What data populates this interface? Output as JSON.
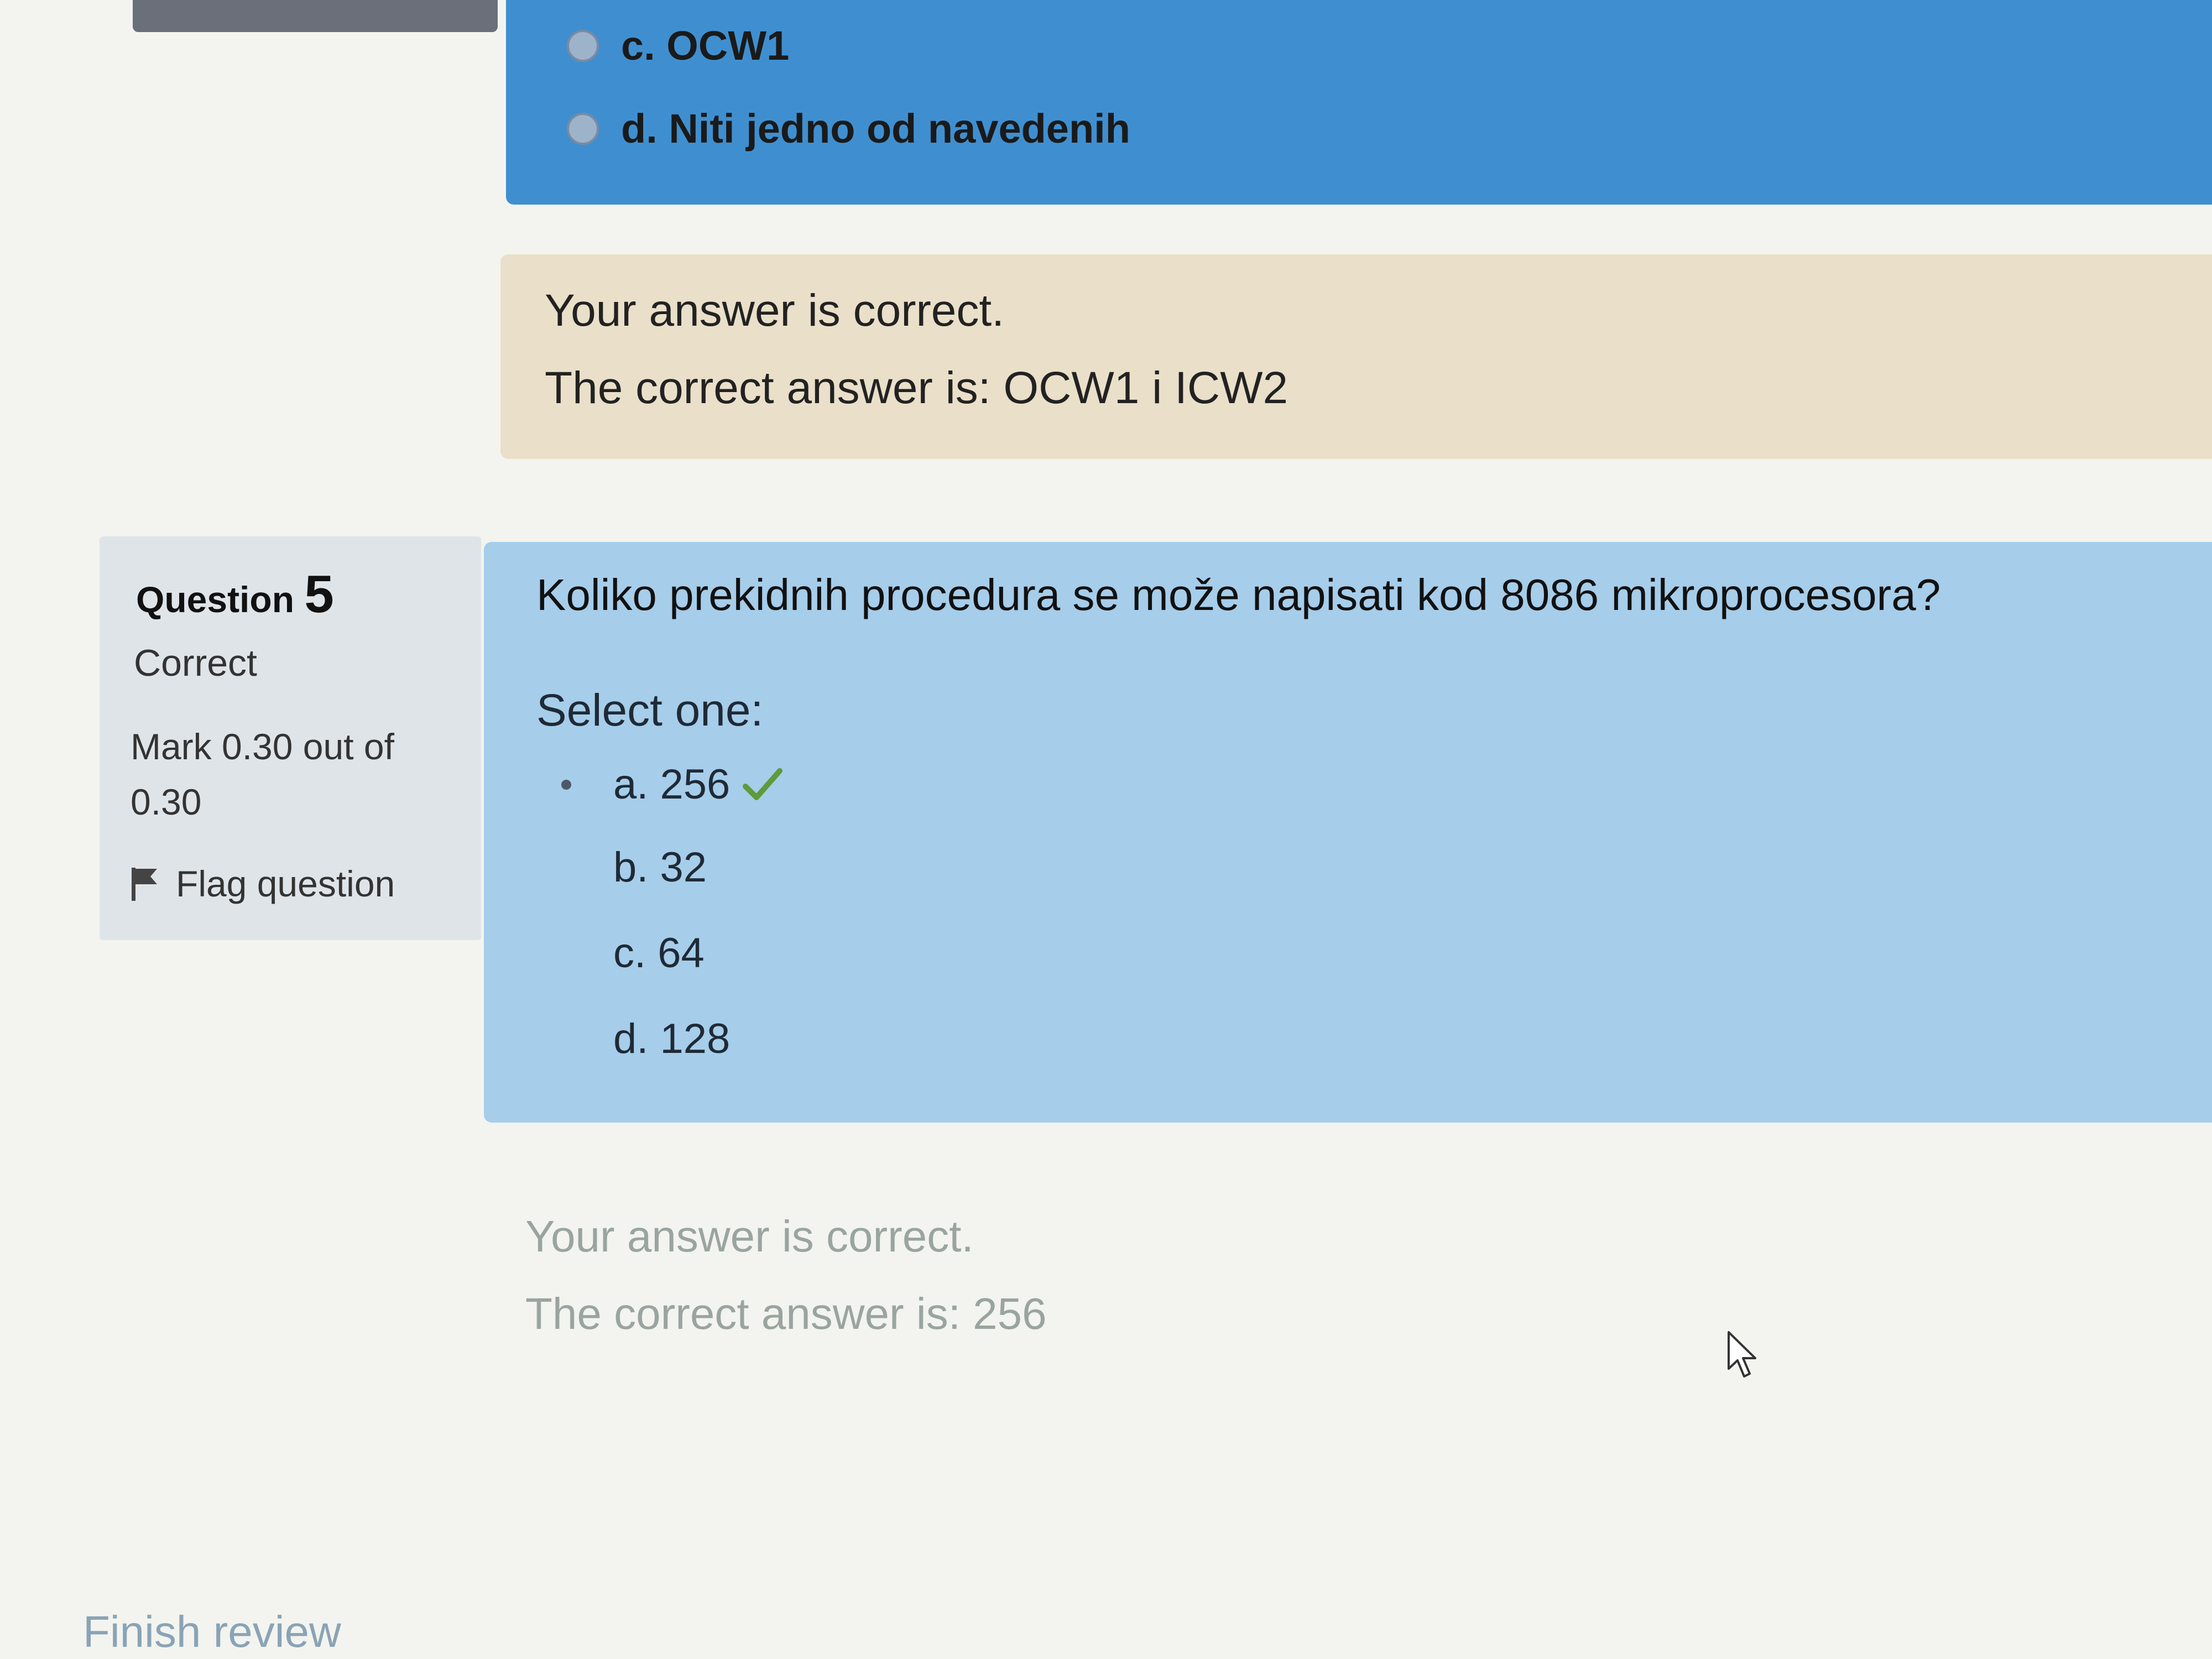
{
  "prev_question": {
    "options": [
      {
        "label": "c. OCW1"
      },
      {
        "label": "d. Niti jedno od navedenih"
      }
    ],
    "feedback": {
      "result": "Your answer is correct.",
      "correct_answer": "The correct answer is: OCW1 i ICW2"
    }
  },
  "question": {
    "heading": "Question",
    "number": "5",
    "state": "Correct",
    "grade": "Mark 0.30 out of 0.30",
    "flag_label": "Flag question",
    "text": "Koliko prekidnih procedura se može napisati kod 8086 mikroprocesora?",
    "prompt": "Select one:",
    "answers": [
      {
        "label": "a. 256",
        "selected": true,
        "correct": true
      },
      {
        "label": "b. 32",
        "selected": false
      },
      {
        "label": "c. 64",
        "selected": false
      },
      {
        "label": "d. 128",
        "selected": false
      }
    ],
    "feedback": {
      "result": "Your answer is correct.",
      "correct_answer": "The correct answer is: 256"
    }
  },
  "footer": {
    "finish_review": "Finish review"
  },
  "colors": {
    "question_blue": "#a6cdea",
    "prev_question_blue": "#3f8fd0",
    "feedback_beige": "#eadfc9",
    "correct_green": "#5f9a3c"
  }
}
